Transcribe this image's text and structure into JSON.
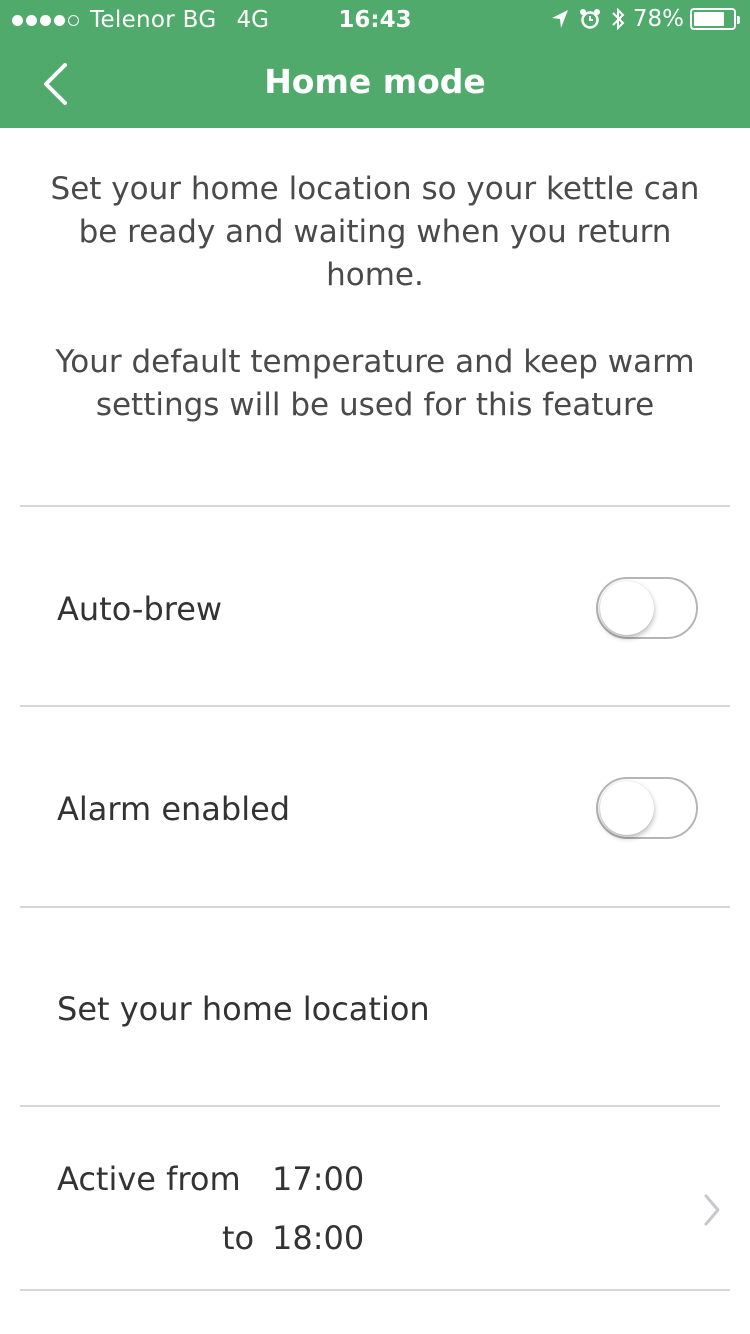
{
  "status_bar": {
    "carrier": "Telenor BG",
    "network": "4G",
    "time": "16:43",
    "battery_percent": "78%",
    "battery_level": 0.78,
    "signal_bars_filled": 4,
    "signal_bars_total": 5,
    "icons": [
      "location-arrow-icon",
      "alarm-clock-icon",
      "bluetooth-icon",
      "battery-icon"
    ]
  },
  "nav": {
    "title": "Home mode",
    "back_icon": "chevron-left-icon"
  },
  "intro": {
    "paragraph_1": "Set your home location so your kettle can be ready and waiting when you return home.",
    "paragraph_2": "Your default temperature and keep warm settings will be used for this feature"
  },
  "settings": {
    "auto_brew": {
      "label": "Auto-brew",
      "enabled": false
    },
    "alarm": {
      "label": "Alarm enabled",
      "enabled": false
    },
    "home_location": {
      "label": "Set your home location"
    },
    "active_period": {
      "from_label": "Active from",
      "from_time": "17:00",
      "to_label": "to",
      "to_time": "18:00",
      "chevron_icon": "chevron-right-icon"
    }
  },
  "colors": {
    "header_green": "#4faa6c",
    "text": "#333333",
    "divider": "#d6d6d6",
    "chevron": "#c7c7cc"
  }
}
